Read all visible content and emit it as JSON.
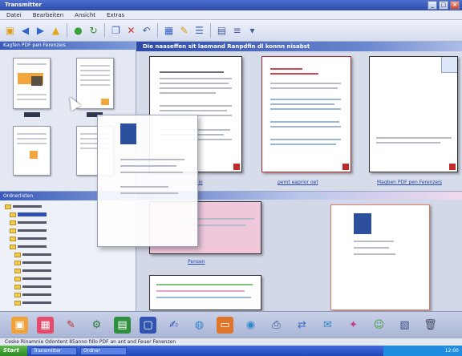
{
  "window": {
    "title": "Transmitter",
    "buttons": [
      "_",
      "□",
      "×"
    ]
  },
  "menu": [
    "Datei",
    "Bearbeiten",
    "Ansicht",
    "Extras"
  ],
  "toolbar": {
    "icons": [
      "folder-icon",
      "back-icon",
      "forward-icon",
      "up-icon",
      "home-icon",
      "refresh-icon",
      "copy-icon",
      "delete-icon",
      "undo-icon",
      "view-icon",
      "sort-icon",
      "filter-icon",
      "layout-icon",
      "list-icon",
      "menu-icon"
    ]
  },
  "left_pane": {
    "header": "Kagfen PDF pen Ferenzeis"
  },
  "main_pane": {
    "header": "Die naaseffen sit laemand Ranpdfin dl konnn nisabst",
    "captions": [
      "alio",
      "pemt eaprior oet",
      "Magben PDF pen Ferenzeis"
    ]
  },
  "folders": {
    "header": "Ordnerlisten"
  },
  "bottom_pane": {
    "caption": "Pensen"
  },
  "dock": {
    "icons": [
      "image-icon",
      "calendar-icon",
      "pen-icon",
      "gear-icon",
      "spreadsheet-icon",
      "document-icon",
      "edit-icon",
      "globe-icon",
      "presentation-icon",
      "web-icon",
      "printer-icon",
      "sync-icon",
      "mail-icon",
      "network-icon",
      "chat-icon",
      "clipboard-icon",
      "trash-icon"
    ]
  },
  "status": {
    "text": "Ceske Rinamnie Odontent 85anno fdlo PDF an ant and Feuer Fenenzen"
  },
  "taskbar": {
    "start_label": "Start",
    "tasks": [
      "Transmitter",
      "Ordner"
    ],
    "clock": "12:00"
  },
  "colors": {
    "accent": "#2b4aa8",
    "orange": "#f3a53e",
    "pdf_red": "#c22a2a"
  }
}
